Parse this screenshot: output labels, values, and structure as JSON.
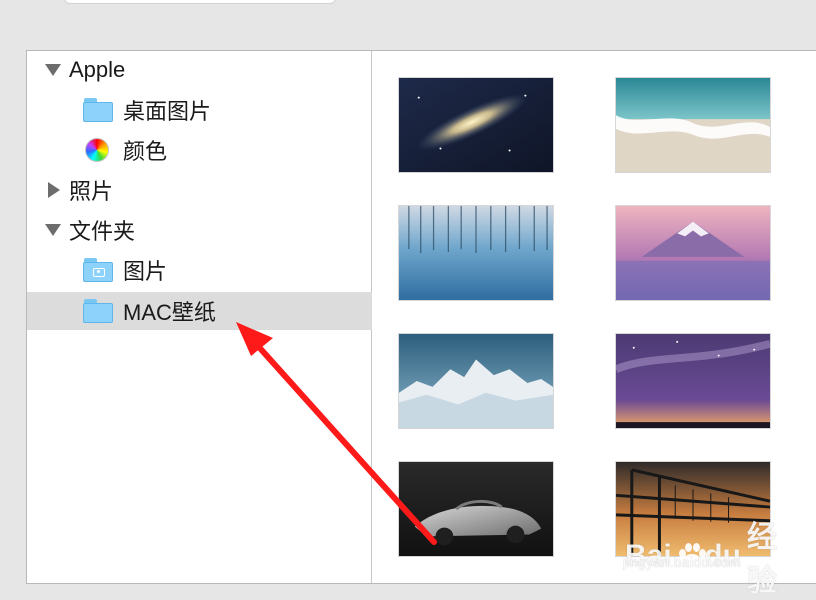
{
  "sidebar": {
    "items": [
      {
        "label": "Apple",
        "icon": "disclosure-triangle-down-icon"
      },
      {
        "label": "桌面图片",
        "icon": "folder-icon"
      },
      {
        "label": "颜色",
        "icon": "color-wheel-icon"
      },
      {
        "label": "照片",
        "icon": "disclosure-triangle-right-icon"
      },
      {
        "label": "文件夹",
        "icon": "disclosure-triangle-down-icon"
      },
      {
        "label": "图片",
        "icon": "folder-camera-icon"
      },
      {
        "label": "MAC壁纸",
        "icon": "folder-icon",
        "selected": true
      }
    ]
  },
  "gallery": {
    "thumbnails": [
      {
        "subject": "galaxy"
      },
      {
        "subject": "beach-wave"
      },
      {
        "subject": "frozen-forest-lake"
      },
      {
        "subject": "mount-fuji-sunset"
      },
      {
        "subject": "snow-mountain-peaks"
      },
      {
        "subject": "milky-way-night-sky"
      },
      {
        "subject": "silver-roadster-car"
      },
      {
        "subject": "bridge-sunset"
      }
    ]
  },
  "annotation": {
    "arrow_color": "#ff1a1a"
  },
  "watermark": {
    "brand": "Bai",
    "brand_suffix": "du",
    "service": "经验",
    "site": "jingyan.baidu.com"
  },
  "colors": {
    "background": "#e6e6e6",
    "selected_row": "#dcdcdc",
    "folder_blue": "#8dd2fb"
  }
}
